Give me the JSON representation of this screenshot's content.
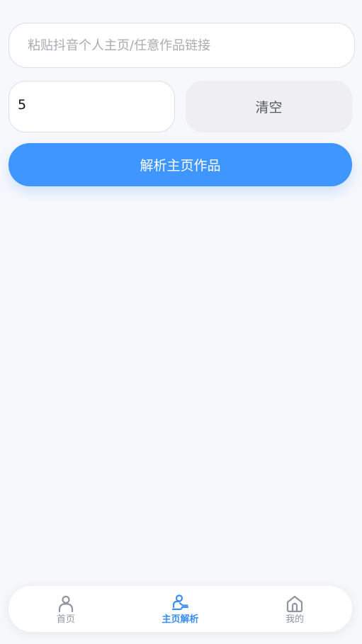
{
  "form": {
    "url_placeholder": "粘贴抖音个人主页/任意作品链接",
    "url_value": "",
    "count_value": "5",
    "clear_label": "清空",
    "parse_label": "解析主页作品"
  },
  "tabbar": {
    "items": [
      {
        "label": "首页",
        "icon": "user-icon",
        "active": false
      },
      {
        "label": "主页解析",
        "icon": "user-scan-icon",
        "active": true
      },
      {
        "label": "我的",
        "icon": "home-icon",
        "active": false
      }
    ]
  },
  "colors": {
    "accent": "#4096ff",
    "tab_active": "#3a8ef6",
    "tab_inactive": "#9096a0",
    "background": "#f7f8fc"
  }
}
